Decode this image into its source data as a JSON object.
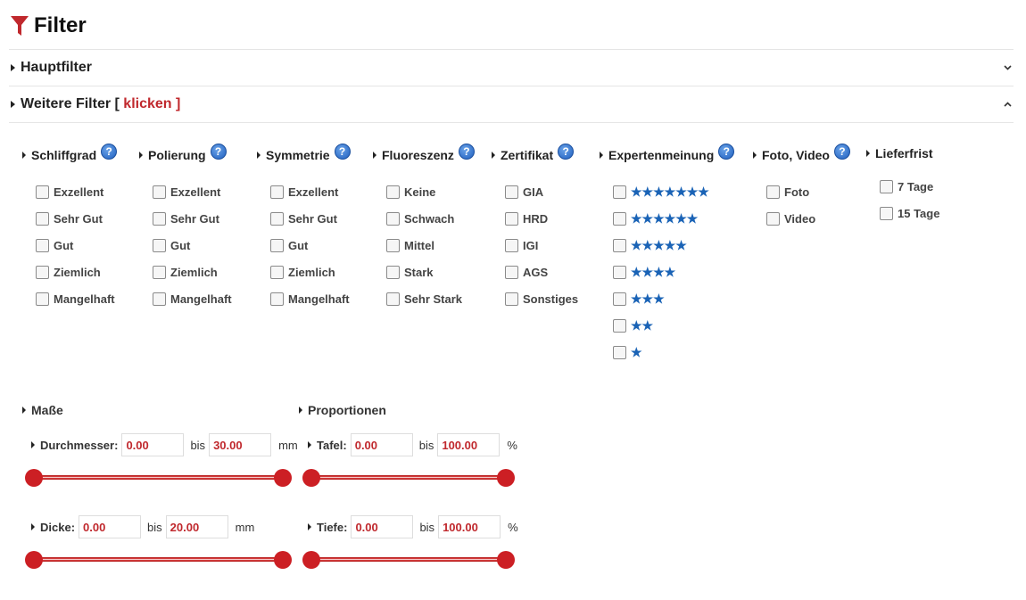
{
  "title": "Filter",
  "colors": {
    "accent": "#c0282d",
    "star": "#1a63b6"
  },
  "sections": {
    "hauptfilter": {
      "label": "Hauptfilter"
    },
    "weitere": {
      "label": "Weitere Filter [ ",
      "link": "klicken ]"
    }
  },
  "columns": [
    {
      "title": "Schliffgrad",
      "help": "?",
      "options": [
        "Exzellent",
        "Sehr Gut",
        "Gut",
        "Ziemlich",
        "Mangelhaft"
      ]
    },
    {
      "title": "Polierung",
      "help": "?",
      "options": [
        "Exzellent",
        "Sehr Gut",
        "Gut",
        "Ziemlich",
        "Mangelhaft"
      ]
    },
    {
      "title": "Symmetrie",
      "help": "?",
      "options": [
        "Exzellent",
        "Sehr Gut",
        "Gut",
        "Ziemlich",
        "Mangelhaft"
      ]
    },
    {
      "title": "Fluoreszenz",
      "help": "?",
      "options": [
        "Keine",
        "Schwach",
        "Mittel",
        "Stark",
        "Sehr Stark"
      ]
    },
    {
      "title": "Zertifikat",
      "help": "?",
      "options": [
        "GIA",
        "HRD",
        "IGI",
        "AGS",
        "Sonstiges"
      ]
    },
    {
      "title": "Expertenmeinung",
      "help": "?",
      "options": [
        7,
        6,
        5,
        4,
        3,
        2,
        1
      ]
    },
    {
      "title": "Foto, Video",
      "help": "?",
      "options": [
        "Foto",
        "Video"
      ]
    },
    {
      "title": "Lieferfrist",
      "options": [
        "7 Tage",
        "15 Tage"
      ]
    }
  ],
  "masse": {
    "title": "Maße",
    "bis": "bis",
    "durchmesser": {
      "label": "Durchmesser:",
      "from": "0.00",
      "to": "30.00",
      "unit": "mm"
    },
    "dicke": {
      "label": "Dicke:",
      "from": "0.00",
      "to": "20.00",
      "unit": "mm"
    }
  },
  "proportionen": {
    "title": "Proportionen",
    "bis": "bis",
    "tafel": {
      "label": "Tafel:",
      "from": "0.00",
      "to": "100.00",
      "unit": "%"
    },
    "tiefe": {
      "label": "Tiefe:",
      "from": "0.00",
      "to": "100.00",
      "unit": "%"
    }
  }
}
